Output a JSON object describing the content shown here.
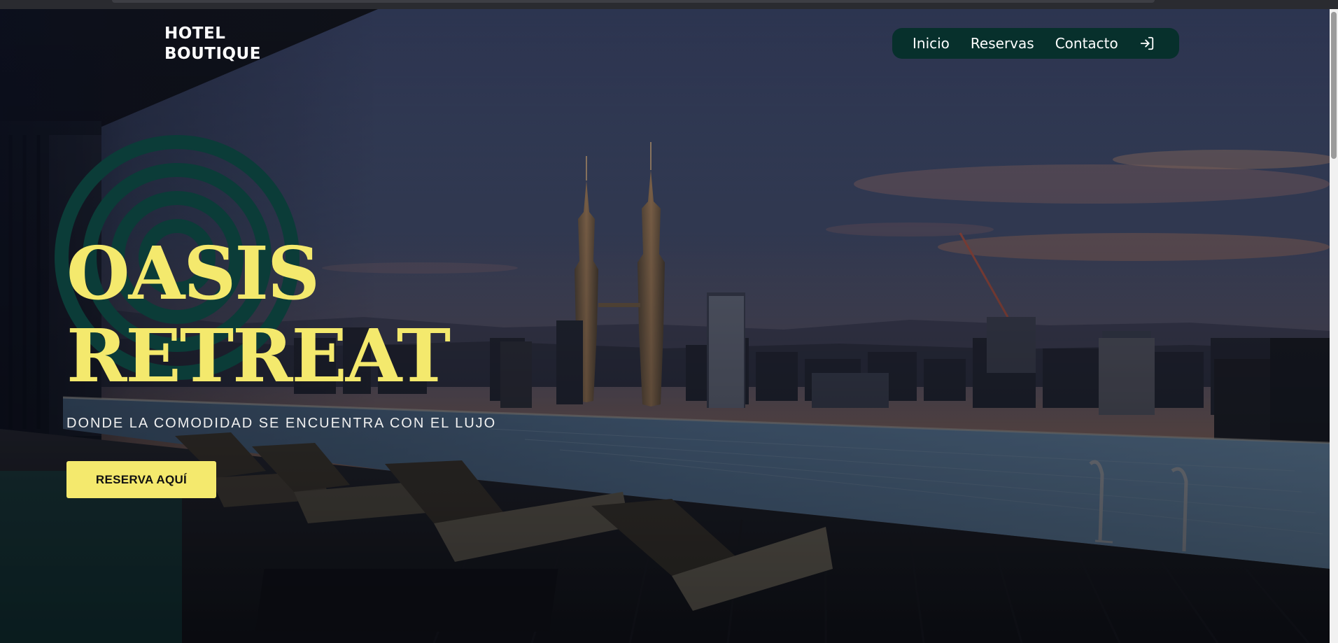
{
  "brand": {
    "line1": "HOTEL",
    "line2": "BOUTIQUE"
  },
  "nav": {
    "items": [
      {
        "label": "Inicio"
      },
      {
        "label": "Reservas"
      },
      {
        "label": "Contacto"
      }
    ],
    "login_icon": "login-icon"
  },
  "hero": {
    "title_line1": "OASIS",
    "title_line2": "RETREAT",
    "tagline": "DONDE LA COMODIDAD SE ENCUENTRA CON EL LUJO",
    "cta_label": "RESERVA AQUÍ",
    "background": "rooftop infinity pool overlooking city skyline with twin towers at dusk"
  },
  "colors": {
    "accent": "#f4e96d",
    "nav_bg": "#07302c",
    "ring": "#0b3c38"
  }
}
